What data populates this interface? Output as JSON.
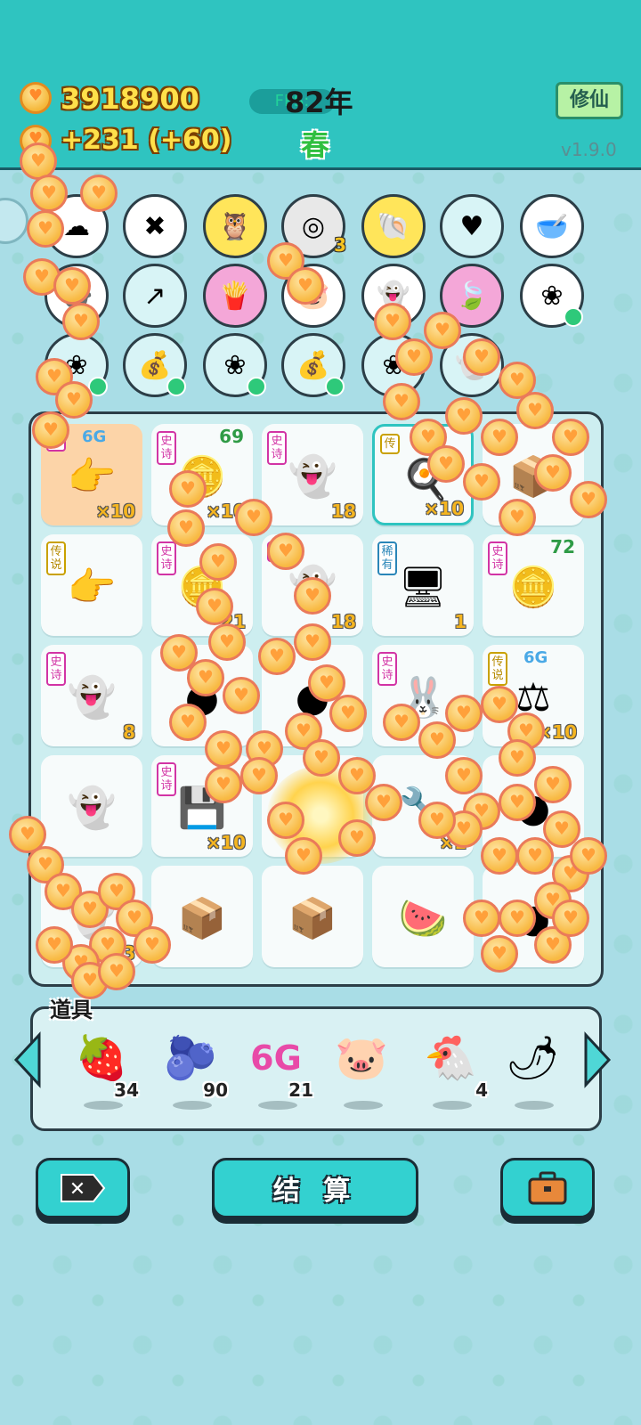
{
  "header": {
    "money": "3918900",
    "income": "+231 (+60)",
    "fps_label": "FPS:",
    "year": "82年",
    "season": "春",
    "xiuxian_label": "修仙",
    "version": "v1.9.0"
  },
  "collection": {
    "row1": [
      {
        "icon": "cotton-icon",
        "count": ""
      },
      {
        "icon": "delete-tag-icon",
        "count": ""
      },
      {
        "icon": "owl-icon",
        "count": ""
      },
      {
        "icon": "egg-tray-icon",
        "count": "3"
      },
      {
        "icon": "seashell-icon",
        "count": ""
      },
      {
        "icon": "heart-fan-icon",
        "count": ""
      },
      {
        "icon": "dog-food-bowl-icon",
        "count": ""
      }
    ],
    "row2": [
      {
        "icon": "pot-icon"
      },
      {
        "icon": "trend-chart-icon"
      },
      {
        "icon": "fries-icon"
      },
      {
        "icon": "piggy-bank-icon"
      },
      {
        "icon": "ghost-face-icon"
      },
      {
        "icon": "leaf-icon"
      },
      {
        "icon": "flower-pot-icon"
      }
    ],
    "row3": [
      {
        "icon": "flower-pot-icon"
      },
      {
        "icon": "money-bag-icon"
      },
      {
        "icon": "flower-pot-icon"
      },
      {
        "icon": "money-bag-icon"
      },
      {
        "icon": "flower-pot-icon"
      },
      {
        "icon": "ghost-icon"
      }
    ]
  },
  "grid": {
    "cells": [
      {
        "tag": "神",
        "badge": "6G",
        "icon": "pointing-hand-icon",
        "count": "×10",
        "top_count": ""
      },
      {
        "tag": "史诗",
        "badge": "",
        "icon": "coin-slice-icon",
        "count": "×10",
        "top_count": "69"
      },
      {
        "tag": "史诗",
        "badge": "",
        "icon": "ghost-icon",
        "count": "18",
        "top_count": ""
      },
      {
        "tag": "传",
        "badge": "",
        "icon": "pressure-cooker-icon",
        "count": "×10",
        "top_count": ""
      },
      {
        "tag": "",
        "badge": "",
        "icon": "box-icon",
        "count": "",
        "top_count": ""
      },
      {
        "tag": "传说",
        "badge": "",
        "icon": "pointing-hand-icon",
        "count": "",
        "top_count": ""
      },
      {
        "tag": "史诗",
        "badge": "",
        "icon": "coin-slice-icon",
        "count": "21",
        "top_count": ""
      },
      {
        "tag": "史",
        "badge": "",
        "icon": "ghost-icon",
        "count": "18",
        "top_count": ""
      },
      {
        "tag": "稀有",
        "badge": "",
        "icon": "computer-tower-icon",
        "count": "1",
        "top_count": ""
      },
      {
        "tag": "史诗",
        "badge": "",
        "icon": "coin-slice-icon",
        "count": "",
        "top_count": "72"
      },
      {
        "tag": "史诗",
        "badge": "",
        "icon": "crowned-ghost-icon",
        "count": "8",
        "top_count": ""
      },
      {
        "tag": "",
        "badge": "",
        "icon": "coin-icon",
        "count": "",
        "top_count": ""
      },
      {
        "tag": "",
        "badge": "",
        "icon": "coin-icon",
        "count": "",
        "top_count": ""
      },
      {
        "tag": "史诗",
        "badge": "",
        "icon": "rabbit-windmill-icon",
        "count": "",
        "top_count": ""
      },
      {
        "tag": "传说",
        "badge": "6G",
        "icon": "scales-icon",
        "count": "×10",
        "top_count": ""
      },
      {
        "tag": "",
        "badge": "",
        "icon": "ghost-icon",
        "count": "",
        "top_count": ""
      },
      {
        "tag": "史诗",
        "badge": "",
        "icon": "graphics-card-icon",
        "count": "×10",
        "top_count": ""
      },
      {
        "tag": "",
        "badge": "",
        "icon": "explosion-icon",
        "count": "",
        "top_count": ""
      },
      {
        "tag": "",
        "badge": "",
        "icon": "tool-icon",
        "count": "×1",
        "top_count": ""
      },
      {
        "tag": "",
        "badge": "",
        "icon": "coin-icon",
        "count": "",
        "top_count": ""
      },
      {
        "tag": "",
        "badge": "",
        "icon": "ghost-icon",
        "count": "3",
        "top_count": ""
      },
      {
        "tag": "",
        "badge": "",
        "icon": "box-icon",
        "count": "",
        "top_count": ""
      },
      {
        "tag": "",
        "badge": "",
        "icon": "box-icon",
        "count": "",
        "top_count": ""
      },
      {
        "tag": "",
        "badge": "",
        "icon": "watermelon-icon",
        "count": "",
        "top_count": ""
      },
      {
        "tag": "",
        "badge": "",
        "icon": "coin-icon",
        "count": "",
        "top_count": ""
      }
    ]
  },
  "items_panel": {
    "title": "道具",
    "items": [
      {
        "icon": "strawberry-icon",
        "count": "34"
      },
      {
        "icon": "blueberry-icon",
        "count": "90"
      },
      {
        "icon": "6g-icon",
        "label": "6G",
        "count": "21"
      },
      {
        "icon": "piggy-bank-icon",
        "count": ""
      },
      {
        "icon": "chicken-icon",
        "count": "4"
      },
      {
        "icon": "chili-icon",
        "count": ""
      }
    ]
  },
  "actions": {
    "settle_label": "结 算"
  }
}
